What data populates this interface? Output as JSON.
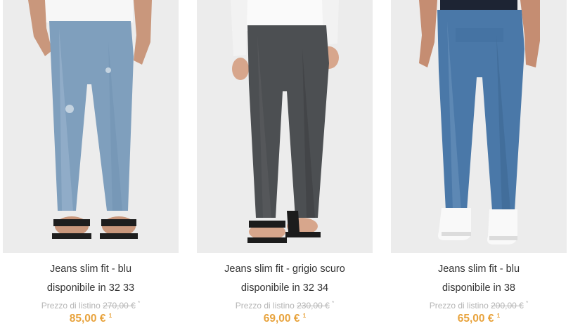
{
  "colors": {
    "price": "#e8a33d",
    "text": "#333333",
    "muted": "#b5b5b5",
    "photo_bg": "#ebebeb"
  },
  "products": [
    {
      "title": "Jeans slim fit - blu",
      "sizes_label": "disponibile in",
      "sizes": "32 33",
      "list_price_label": "Prezzo di listino",
      "list_price": "270,00 €",
      "list_price_note": "*",
      "price": "85,00 €",
      "price_note": "1",
      "image": "light-blue-jeans-with-black-sandals"
    },
    {
      "title": "Jeans slim fit - grigio scuro",
      "sizes_label": "disponibile in",
      "sizes": "32 34",
      "list_price_label": "Prezzo di listino",
      "list_price": "230,00 €",
      "list_price_note": "*",
      "price": "69,00 €",
      "price_note": "1",
      "image": "dark-grey-jeans-with-black-sandals"
    },
    {
      "title": "Jeans slim fit - blu",
      "sizes_label": "disponibile in",
      "sizes": "38",
      "list_price_label": "Prezzo di listino",
      "list_price": "200,00 €",
      "list_price_note": "*",
      "price": "65,00 €",
      "price_note": "1",
      "image": "blue-jeans-with-white-sneakers"
    }
  ]
}
